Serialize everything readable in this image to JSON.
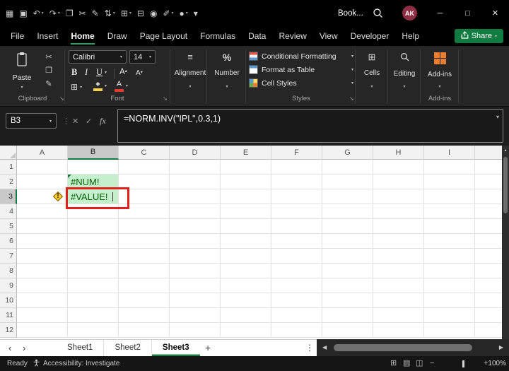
{
  "colors": {
    "accent_green": "#21A366",
    "share_green": "#107C41",
    "cell_fill_green": "#C6EFCE",
    "cell_text_green": "#006100",
    "annotation_red": "#E0201D",
    "addins_orange": "#ED7D31",
    "avatar_maroon": "#8E2F43",
    "warning_yellow": "#FFC928"
  },
  "titlebar": {
    "title": "Book...",
    "avatar_initials": "AK",
    "icons": [
      {
        "name": "excel-grid-icon",
        "glyph": "▦"
      },
      {
        "name": "save-icon",
        "glyph": "▣"
      },
      {
        "name": "undo-icon",
        "glyph": "↶",
        "chevron": true
      },
      {
        "name": "redo-icon",
        "glyph": "↷",
        "chevron": true
      },
      {
        "name": "copy-icon",
        "glyph": "❐"
      },
      {
        "name": "cut-icon",
        "glyph": "✂"
      },
      {
        "name": "format-painter-icon",
        "glyph": "✎"
      },
      {
        "name": "sort-filter-icon",
        "glyph": "⇅",
        "chevron": true
      },
      {
        "name": "borders-icon",
        "glyph": "⊞",
        "chevron": true
      },
      {
        "name": "print-icon",
        "glyph": "⊟"
      },
      {
        "name": "camera-icon",
        "glyph": "◉"
      },
      {
        "name": "draw-pen-icon",
        "glyph": "✐",
        "chevron": true
      },
      {
        "name": "record-icon",
        "glyph": "●",
        "chevron": true
      },
      {
        "name": "more-commands-icon",
        "glyph": "▾"
      }
    ],
    "window_controls": {
      "minimize": "─",
      "maximize": "□",
      "close": "✕"
    }
  },
  "menubar": {
    "items": [
      "File",
      "Insert",
      "Home",
      "Draw",
      "Page Layout",
      "Formulas",
      "Data",
      "Review",
      "View",
      "Developer",
      "Help"
    ],
    "active": "Home",
    "share_label": "Share"
  },
  "ribbon": {
    "paste_label": "Paste",
    "font_name": "Calibri",
    "font_size": "14",
    "bold": "B",
    "italic": "I",
    "underline": "U",
    "grow_font": "A",
    "shrink_font": "A",
    "font_color": "A",
    "alignment_label": "Alignment",
    "number_label": "Number",
    "styles_items": [
      "Conditional Formatting",
      "Format as Table",
      "Cell Styles"
    ],
    "cells_label": "Cells",
    "editing_label": "Editing",
    "addins_label": "Add-ins",
    "group_labels": {
      "clipboard": "Clipboard",
      "font": "Font",
      "styles": "Styles",
      "addins": "Add-ins"
    }
  },
  "formula_bar": {
    "name_box": "B3",
    "cancel": "✕",
    "enter": "✓",
    "fx": "fx",
    "formula": "=NORM.INV(\"IPL\",0.3,1)"
  },
  "grid": {
    "columns": [
      "A",
      "B",
      "C",
      "D",
      "E",
      "F",
      "G",
      "H",
      "I"
    ],
    "rows": [
      1,
      2,
      3,
      4,
      5,
      6,
      7,
      8,
      9,
      10,
      11,
      12
    ],
    "selected_column": "B",
    "selected_row": 3,
    "cells": [
      {
        "ref": "B2",
        "value": "#NUM!",
        "fill": "#C6EFCE",
        "text_color": "#006100",
        "error_marker": true
      },
      {
        "ref": "B3",
        "value": "#VALUE!",
        "fill": "#C6EFCE",
        "text_color": "#006100",
        "caret": true
      }
    ],
    "warning_cell": "A3"
  },
  "sheetbar": {
    "tabs": [
      "Sheet1",
      "Sheet2",
      "Sheet3"
    ],
    "active": "Sheet3",
    "add_label": "+",
    "nav_left": "‹",
    "nav_right": "›",
    "menu_dots": "⋮",
    "scroll_left": "◀",
    "scroll_right": "▶"
  },
  "statusbar": {
    "mode": "Ready",
    "accessibility": "Accessibility: Investigate",
    "zoom_out": "−",
    "zoom_in": "+",
    "zoom_level": "100%"
  },
  "glyphs": {
    "chevron_down": "▾",
    "dots_vertical": "⋮",
    "align_icon": "≡",
    "percent": "%",
    "cells_icon": "⊞",
    "borders_icon": "⊞",
    "bucket_icon": "◆",
    "scroll_up": "▴",
    "shrink_arrow": "▾",
    "cut": "✂",
    "copy": "❐",
    "brush": "✎",
    "launcher": "↘",
    "view_normal": "⊞",
    "view_layout": "▤",
    "view_break": "◫"
  }
}
